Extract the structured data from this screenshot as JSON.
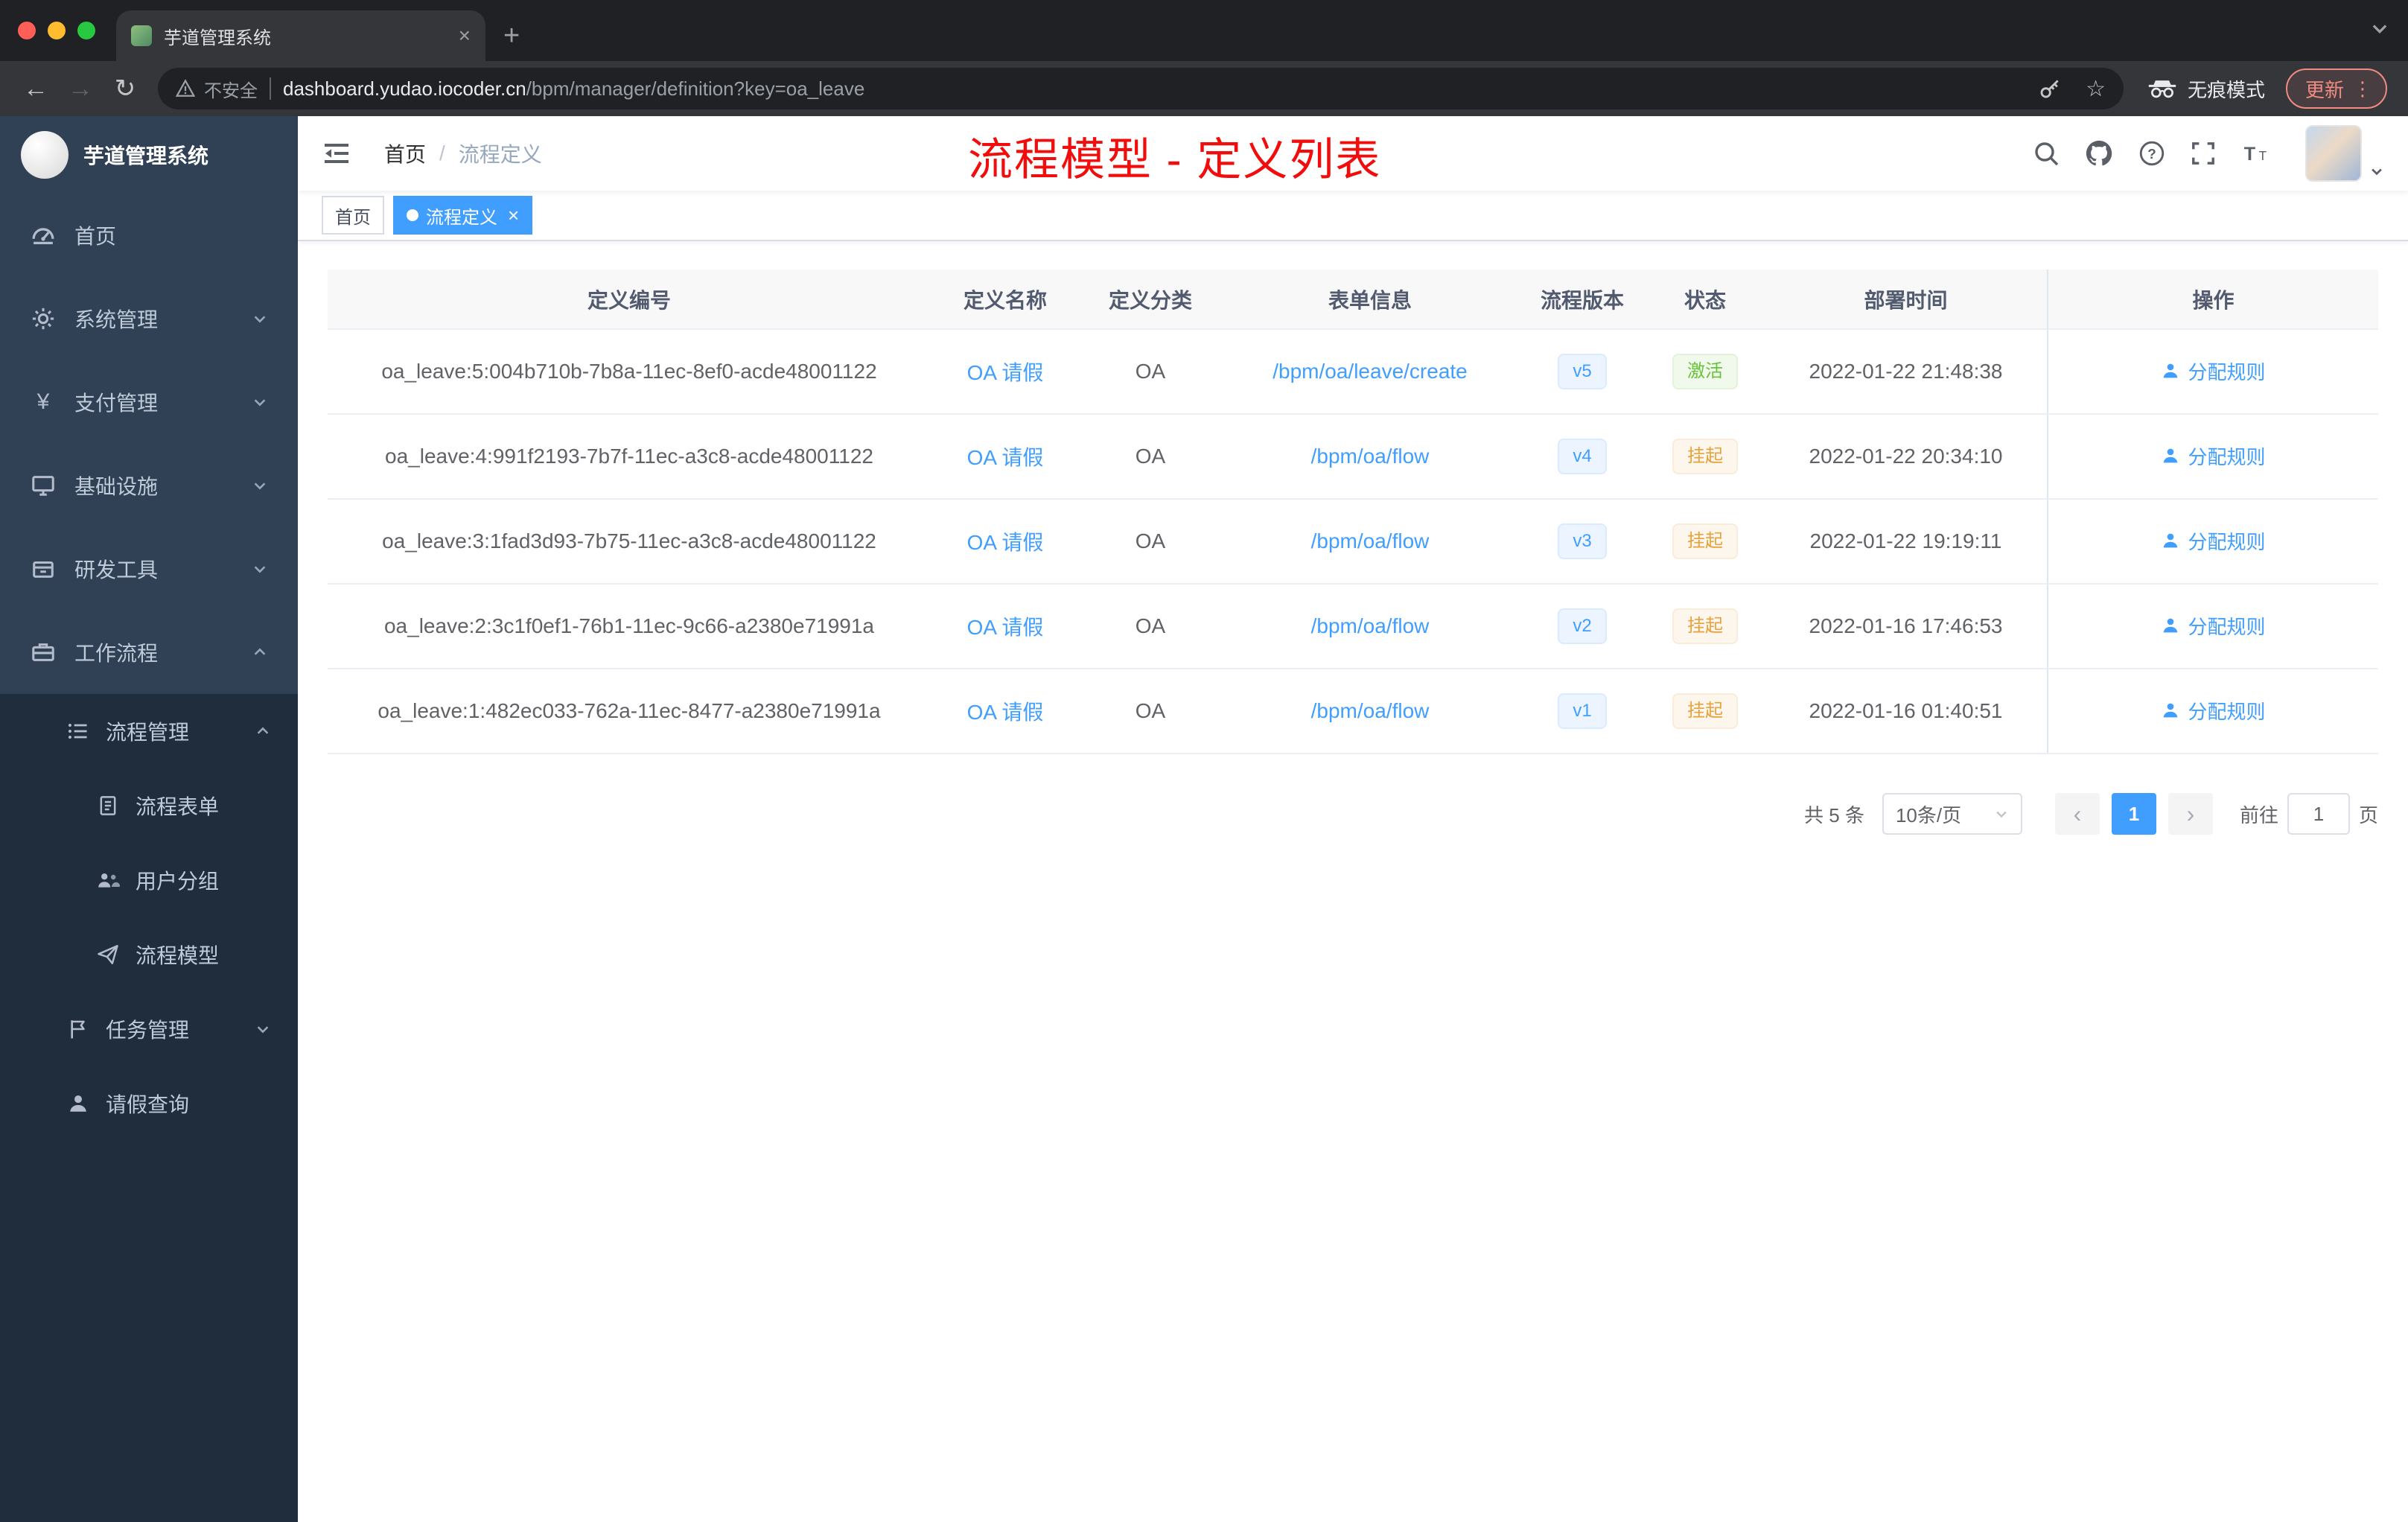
{
  "browser": {
    "tab": {
      "title": "芋道管理系统"
    },
    "address": {
      "security_label": "不安全",
      "domain": "dashboard.yudao.iocoder.cn",
      "path": "/bpm/manager/definition?key=oa_leave",
      "incognito_label": "无痕模式",
      "update_label": "更新"
    }
  },
  "sidebar": {
    "logo_title": "芋道管理系统",
    "items": [
      {
        "label": "首页",
        "icon": "dashboard-icon"
      },
      {
        "label": "系统管理",
        "icon": "gear-icon"
      },
      {
        "label": "支付管理",
        "icon": "yen-icon"
      },
      {
        "label": "基础设施",
        "icon": "infrastructure-icon"
      },
      {
        "label": "研发工具",
        "icon": "dev-tools-icon"
      },
      {
        "label": "工作流程",
        "icon": "workflow-icon"
      }
    ],
    "submenu": [
      {
        "label": "流程管理",
        "icon": "list-icon"
      },
      {
        "label": "流程表单",
        "icon": "form-icon"
      },
      {
        "label": "用户分组",
        "icon": "user-group-icon"
      },
      {
        "label": "流程模型",
        "icon": "paper-plane-icon"
      },
      {
        "label": "任务管理",
        "icon": "task-icon"
      },
      {
        "label": "请假查询",
        "icon": "person-icon"
      }
    ]
  },
  "header": {
    "breadcrumb_home": "首页",
    "breadcrumb_sep": "/",
    "breadcrumb_current": "流程定义",
    "annotation": "流程模型 - 定义列表"
  },
  "tags": {
    "home": "首页",
    "active": "流程定义",
    "close_glyph": "×"
  },
  "table": {
    "columns": [
      "定义编号",
      "定义名称",
      "定义分类",
      "表单信息",
      "流程版本",
      "状态",
      "部署时间",
      "操作"
    ],
    "action_label": "分配规则",
    "rows": [
      {
        "id": "oa_leave:5:004b710b-7b8a-11ec-8ef0-acde48001122",
        "name": "OA 请假",
        "category": "OA",
        "form": "/bpm/oa/leave/create",
        "version": "v5",
        "status": "激活",
        "status_type": "success",
        "time": "2022-01-22 21:48:38"
      },
      {
        "id": "oa_leave:4:991f2193-7b7f-11ec-a3c8-acde48001122",
        "name": "OA 请假",
        "category": "OA",
        "form": "/bpm/oa/flow",
        "version": "v4",
        "status": "挂起",
        "status_type": "warning",
        "time": "2022-01-22 20:34:10"
      },
      {
        "id": "oa_leave:3:1fad3d93-7b75-11ec-a3c8-acde48001122",
        "name": "OA 请假",
        "category": "OA",
        "form": "/bpm/oa/flow",
        "version": "v3",
        "status": "挂起",
        "status_type": "warning",
        "time": "2022-01-22 19:19:11"
      },
      {
        "id": "oa_leave:2:3c1f0ef1-76b1-11ec-9c66-a2380e71991a",
        "name": "OA 请假",
        "category": "OA",
        "form": "/bpm/oa/flow",
        "version": "v2",
        "status": "挂起",
        "status_type": "warning",
        "time": "2022-01-16 17:46:53"
      },
      {
        "id": "oa_leave:1:482ec033-762a-11ec-8477-a2380e71991a",
        "name": "OA 请假",
        "category": "OA",
        "form": "/bpm/oa/flow",
        "version": "v1",
        "status": "挂起",
        "status_type": "warning",
        "time": "2022-01-16 01:40:51"
      }
    ]
  },
  "pagination": {
    "total": "共 5 条",
    "page_size": "10条/页",
    "prev": "‹",
    "page": "1",
    "next": "›",
    "goto_label": "前往",
    "goto_value": "1",
    "page_unit": "页"
  },
  "colors": {
    "accent": "#409eff",
    "success": "#67c23a",
    "warning": "#e6a23c",
    "annotation_red": "#f20d0d",
    "sidebar_bg": "#304156",
    "sidebar_sub_bg": "#1f2d3d"
  }
}
